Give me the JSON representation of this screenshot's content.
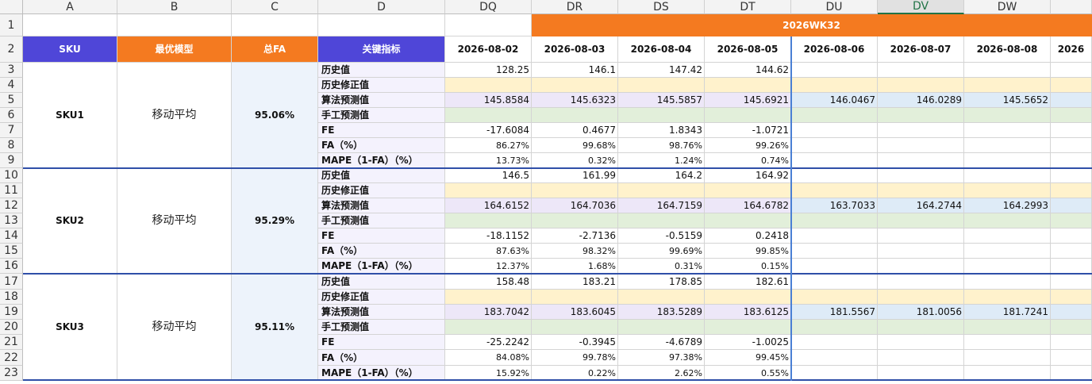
{
  "columns": {
    "letters": [
      "A",
      "B",
      "C",
      "D",
      "DQ",
      "DR",
      "DS",
      "DT",
      "DU",
      "DV",
      "DW",
      ""
    ],
    "selected_index": 9
  },
  "header_row": {
    "week_label": "2026WK32",
    "sku": "SKU",
    "best_model": "最优模型",
    "total_fa": "总FA",
    "key_metric": "关键指标",
    "dates": [
      "2026-08-02",
      "2026-08-03",
      "2026-08-04",
      "2026-08-05",
      "2026-08-06",
      "2026-08-07",
      "2026-08-08",
      "2026"
    ]
  },
  "metric_labels": [
    "历史值",
    "历史修正值",
    "算法预测值",
    "手工预测值",
    "FE",
    "FA（%）",
    "MAPE（1-FA）（%）"
  ],
  "skus": [
    {
      "name": "SKU1",
      "model": "移动平均",
      "fa": "95.06%",
      "rows": [
        [
          "128.25",
          "146.1",
          "147.42",
          "144.62",
          "",
          "",
          "",
          ""
        ],
        [
          "",
          "",
          "",
          "",
          "",
          "",
          "",
          ""
        ],
        [
          "145.8584",
          "145.6323",
          "145.5857",
          "145.6921",
          "146.0467",
          "146.0289",
          "145.5652",
          ""
        ],
        [
          "",
          "",
          "",
          "",
          "",
          "",
          "",
          ""
        ],
        [
          "-17.6084",
          "0.4677",
          "1.8343",
          "-1.0721",
          "",
          "",
          "",
          ""
        ],
        [
          "86.27%",
          "99.68%",
          "98.76%",
          "99.26%",
          "",
          "",
          "",
          ""
        ],
        [
          "13.73%",
          "0.32%",
          "1.24%",
          "0.74%",
          "",
          "",
          "",
          ""
        ]
      ]
    },
    {
      "name": "SKU2",
      "model": "移动平均",
      "fa": "95.29%",
      "rows": [
        [
          "146.5",
          "161.99",
          "164.2",
          "164.92",
          "",
          "",
          "",
          ""
        ],
        [
          "",
          "",
          "",
          "",
          "",
          "",
          "",
          ""
        ],
        [
          "164.6152",
          "164.7036",
          "164.7159",
          "164.6782",
          "163.7033",
          "164.2744",
          "164.2993",
          ""
        ],
        [
          "",
          "",
          "",
          "",
          "",
          "",
          "",
          ""
        ],
        [
          "-18.1152",
          "-2.7136",
          "-0.5159",
          "0.2418",
          "",
          "",
          "",
          ""
        ],
        [
          "87.63%",
          "98.32%",
          "99.69%",
          "99.85%",
          "",
          "",
          "",
          ""
        ],
        [
          "12.37%",
          "1.68%",
          "0.31%",
          "0.15%",
          "",
          "",
          "",
          ""
        ]
      ]
    },
    {
      "name": "SKU3",
      "model": "移动平均",
      "fa": "95.11%",
      "rows": [
        [
          "158.48",
          "183.21",
          "178.85",
          "182.61",
          "",
          "",
          "",
          ""
        ],
        [
          "",
          "",
          "",
          "",
          "",
          "",
          "",
          ""
        ],
        [
          "183.7042",
          "183.6045",
          "183.5289",
          "183.6125",
          "181.5567",
          "181.0056",
          "181.7241",
          ""
        ],
        [
          "",
          "",
          "",
          "",
          "",
          "",
          "",
          ""
        ],
        [
          "-25.2242",
          "-0.3945",
          "-4.6789",
          "-1.0025",
          "",
          "",
          "",
          ""
        ],
        [
          "84.08%",
          "99.78%",
          "97.38%",
          "99.45%",
          "",
          "",
          "",
          ""
        ],
        [
          "15.92%",
          "0.22%",
          "2.62%",
          "0.55%",
          "",
          "",
          "",
          ""
        ]
      ]
    }
  ],
  "row_bands": {
    "hist_fix": "#fff2cc",
    "algo_past": "#ede7f8",
    "algo_future": "#deebf7",
    "manual": "#e2efda",
    "plain": "#ffffff"
  },
  "colors": {
    "header_blue": "#4f46d8",
    "header_orange": "#f47a20",
    "fa_fill": "#edf3fb",
    "metric_fill": "#f4f2fd"
  }
}
